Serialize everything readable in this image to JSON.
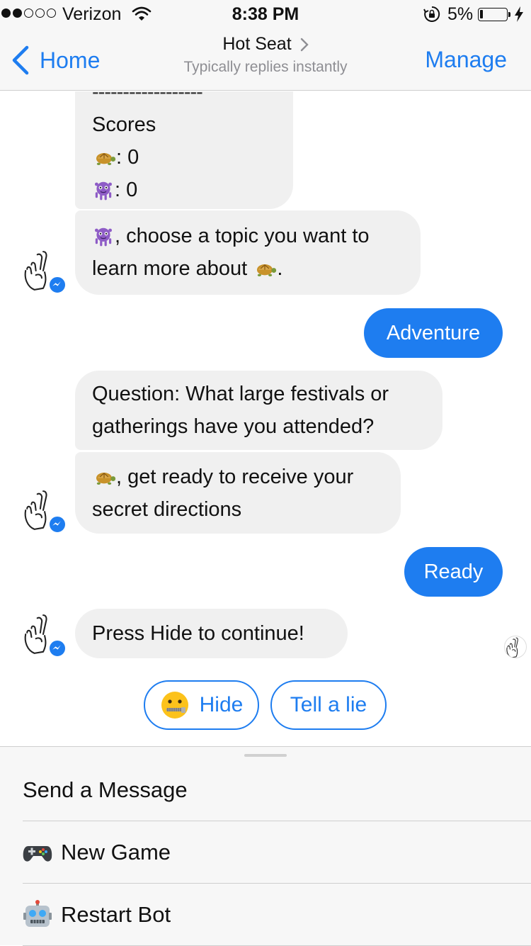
{
  "status_bar": {
    "carrier": "Verizon",
    "time": "8:38 PM",
    "battery_percent": "5%",
    "signal_bars_filled": 2,
    "signal_bars_total": 5
  },
  "nav": {
    "back_label": "Home",
    "title": "Hot Seat",
    "subtitle": "Typically replies instantly",
    "manage_label": "Manage",
    "accent_color": "#1e7df0"
  },
  "chat": {
    "scores_divider": "------------------",
    "scores_title": "Scores",
    "score_turtle": ": 0",
    "score_alien": ": 0",
    "msg_choose_topic_1": ", choose a topic you want to",
    "msg_choose_topic_2": "learn more about",
    "msg_choose_topic_3": ".",
    "reply_adventure": "Adventure",
    "msg_question_1": "Question: What large festivals or",
    "msg_question_2": "gatherings have you attended?",
    "msg_get_ready_1": ", get ready to receive your",
    "msg_get_ready_2": "secret directions",
    "reply_ready": "Ready",
    "msg_press_hide": "Press Hide to continue!",
    "bubble_in_color": "#f0f0f0",
    "bubble_out_color": "#1e7df0"
  },
  "quick_replies": {
    "hide_label": "Hide",
    "tell_lie_label": "Tell a lie"
  },
  "menu": {
    "send_message": "Send a Message",
    "new_game": "New Game",
    "restart_bot": "Restart Bot"
  }
}
